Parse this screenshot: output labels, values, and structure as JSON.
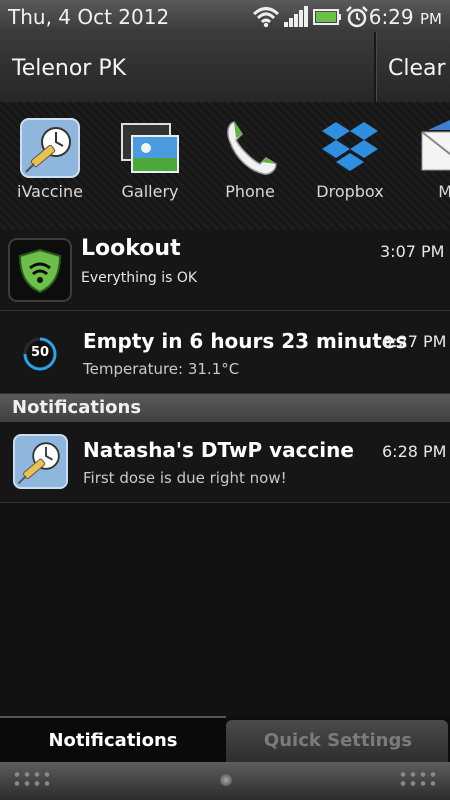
{
  "status_bar": {
    "date": "Thu, 4 Oct 2012",
    "time": "6:29",
    "time_suffix": "PM"
  },
  "carrier": "Telenor PK",
  "clear_label": "Clear",
  "recent_apps": [
    {
      "label": "iVaccine",
      "icon": "ivaccine-icon"
    },
    {
      "label": "Gallery",
      "icon": "gallery-icon"
    },
    {
      "label": "Phone",
      "icon": "phone-icon"
    },
    {
      "label": "Dropbox",
      "icon": "dropbox-icon"
    },
    {
      "label": "Ma",
      "icon": "mail-icon"
    }
  ],
  "ongoing": [
    {
      "title": "Lookout",
      "subtitle": "Everything is OK",
      "time": "3:07 PM",
      "icon": "lookout-shield-icon"
    },
    {
      "title": "Empty in 6 hours 23 minutes",
      "subtitle": "Temperature: 31.1°C",
      "time": "6:27 PM",
      "icon": "battery-icon",
      "badge": "50"
    }
  ],
  "section_label": "Notifications",
  "notifications": [
    {
      "title": "Natasha's DTwP vaccine",
      "subtitle": "First dose is due right now!",
      "time": "6:28 PM",
      "icon": "ivaccine-icon"
    }
  ],
  "tabs": {
    "notifications": "Notifications",
    "quick_settings": "Quick Settings"
  },
  "colors": {
    "lookout_green": "#6cc04a",
    "battery_ring": "#2aa3e8",
    "dropbox_blue": "#2e8ee0"
  }
}
